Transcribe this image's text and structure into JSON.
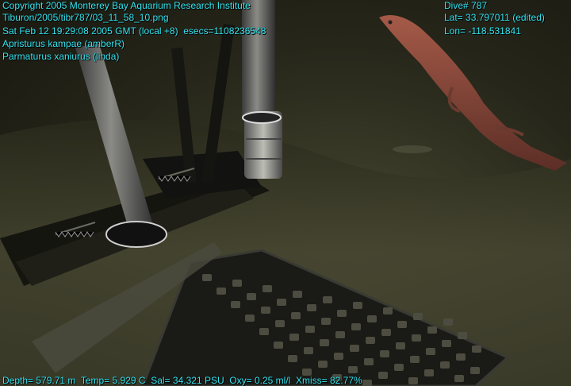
{
  "overlay": {
    "copyright": "Copyright 2005 Monterey Bay Aquarium Research Institute",
    "file_path": "Tiburon/2005/tibr787/03_11_58_10.png",
    "timestamp": "Sat Feb 12 19:29:08 2005 GMT (local +8)  esecs=1108236548",
    "species_1": "Apristurus kampae (amberR)",
    "species_2": "Parmaturus xaniurus (linda)",
    "dive": "Dive# 787",
    "latitude": "Lat= 33.797011 (edited)",
    "longitude": "Lon= -118.531841",
    "telemetry": "Depth= 579.71 m  Temp= 5.929 C  Sal= 34.321 PSU  Oxy= 0.25 ml/l  Xmiss= 82.77%"
  },
  "colors": {
    "overlay_text": "#35e6f2",
    "seafloor": "#4a4a34",
    "shark": "#8a4a3c"
  }
}
